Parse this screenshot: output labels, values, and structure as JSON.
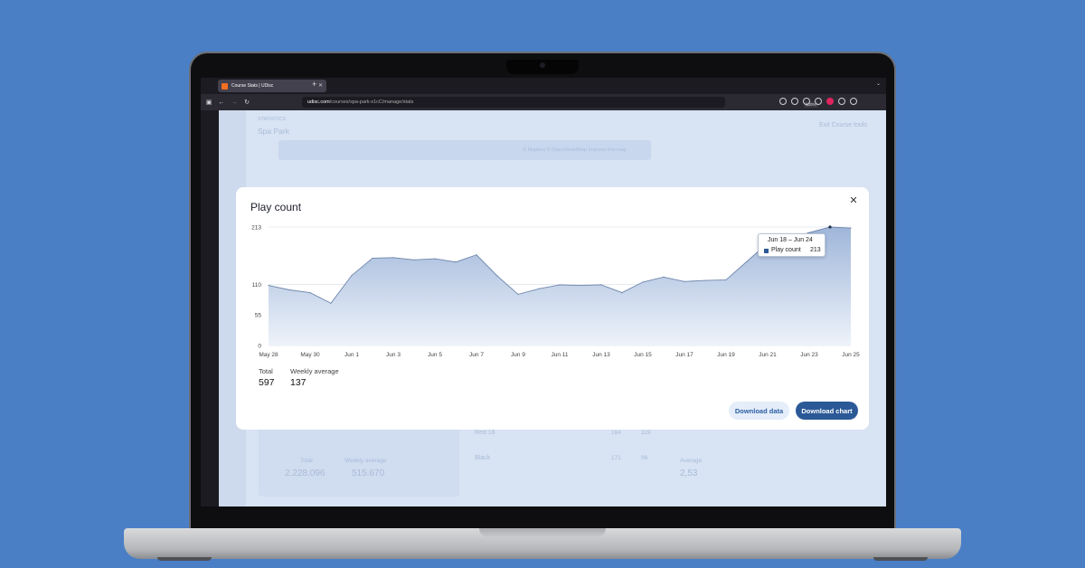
{
  "browser": {
    "tab_title": "Course Stats | UDisc",
    "url_host": "udisc.com",
    "url_path": "/courses/spa-park-x1cC/manage/stats",
    "zoom": "120%"
  },
  "page": {
    "section": "STATISTICS",
    "course_name": "Spa Park",
    "exit_label": "Exit Course tools",
    "map_attribution": "© Mapbox © OpenStreetMap",
    "map_improve": "Improve this map",
    "bg_total_label": "Total",
    "bg_total_value": "2.228.096",
    "bg_weekly_label": "Weekly average",
    "bg_weekly_value": "515.670",
    "bg_layout1": "Red 18",
    "bg_layout1_a": "164",
    "bg_layout1_b": "119",
    "bg_layout2": "Black",
    "bg_layout2_a": "171",
    "bg_layout2_b": "96",
    "bg_average_label": "Average",
    "bg_average_value": "2,53"
  },
  "modal": {
    "title": "Play count",
    "total_label": "Total",
    "total_value": "597",
    "weekly_label": "Weekly average",
    "weekly_value": "137",
    "download_data": "Download data",
    "download_chart": "Download chart",
    "tooltip_title": "Jun 18 – Jun 24",
    "tooltip_series": "Play count",
    "tooltip_value": "213"
  },
  "colors": {
    "accent": "#2b5997",
    "background": "#4a7fc6"
  },
  "chart_data": {
    "type": "area",
    "title": "Play count",
    "yticks": [
      0,
      55,
      110,
      213
    ],
    "ylim": [
      0,
      213
    ],
    "xtick_labels": [
      "May 28",
      "May 30",
      "Jun 1",
      "Jun 3",
      "Jun 5",
      "Jun 7",
      "Jun 9",
      "Jun 11",
      "Jun 13",
      "Jun 15",
      "Jun 17",
      "Jun 19",
      "Jun 21",
      "Jun 23",
      "Jun 25"
    ],
    "x_days": [
      0,
      1,
      2,
      3,
      4,
      5,
      6,
      7,
      8,
      9,
      10,
      11,
      12,
      13,
      14,
      15,
      16,
      17,
      18,
      19,
      20,
      21,
      22,
      23,
      24,
      25,
      26,
      27,
      28
    ],
    "values": [
      108,
      100,
      95,
      76,
      126,
      157,
      158,
      154,
      156,
      150,
      163,
      125,
      92,
      102,
      109,
      108,
      109,
      95,
      114,
      123,
      115,
      117,
      118,
      151,
      184,
      190,
      203,
      213,
      211
    ]
  }
}
